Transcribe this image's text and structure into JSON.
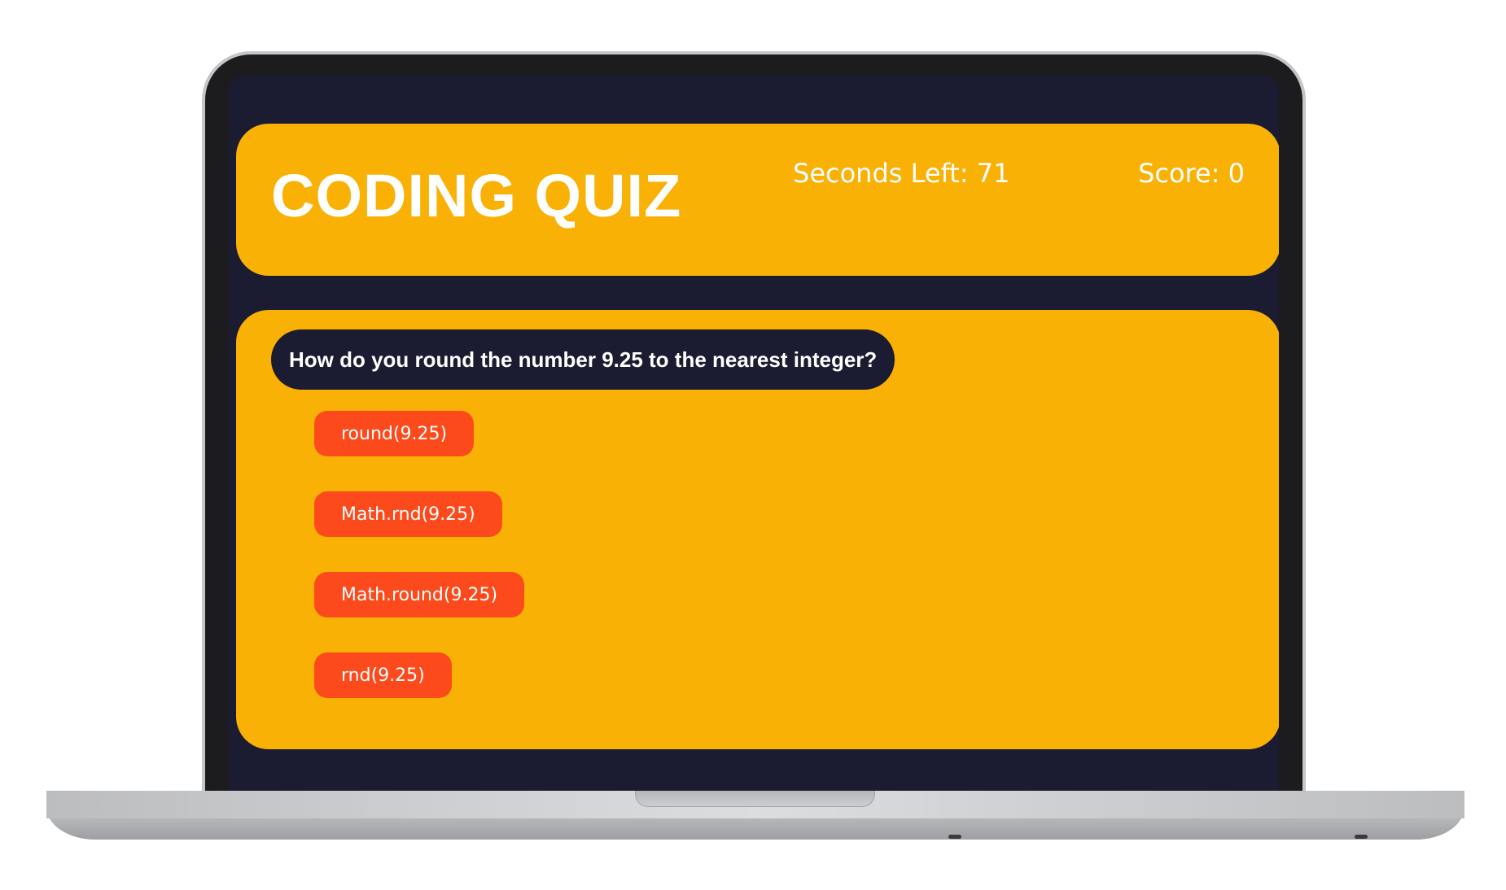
{
  "header": {
    "title": "CODING QUIZ",
    "timer_text": "Seconds Left: 71",
    "score_text": "Score: 0"
  },
  "question": {
    "text": "How do you round the number 9.25 to the nearest integer?",
    "answers": [
      {
        "label": "round(9.25)"
      },
      {
        "label": "Math.rnd(9.25)"
      },
      {
        "label": "Math.round(9.25)"
      },
      {
        "label": "rnd(9.25)"
      }
    ]
  },
  "colors": {
    "card": "#f9b106",
    "screen_bg": "#1b1b31",
    "answer_button": "#fc4a1c",
    "text": "#ffffff"
  }
}
